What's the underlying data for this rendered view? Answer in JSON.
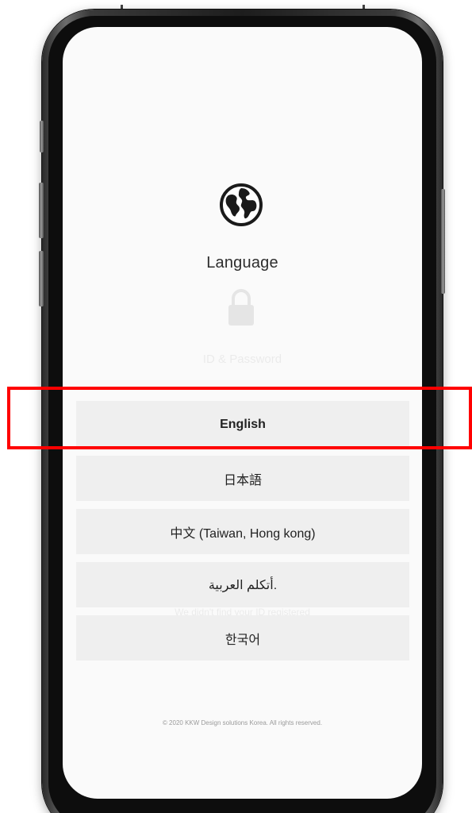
{
  "screen": {
    "title": "Language",
    "icon": "globe-icon",
    "background_hint_1": "ID & Password",
    "background_hint_2": "We didn't find your ID registered"
  },
  "languages": [
    {
      "label": "English",
      "selected": true
    },
    {
      "label": "日本語",
      "selected": false
    },
    {
      "label": "中文 (Taiwan, Hong kong)",
      "selected": false
    },
    {
      "label": "أتكلم العربية.",
      "selected": false
    },
    {
      "label": "한국어",
      "selected": false
    }
  ],
  "footer": {
    "copyright": "© 2020 KKW Design solutions Korea. All rights reserved."
  },
  "colors": {
    "highlight": "#ff0000",
    "item_bg": "#efefef",
    "screen_bg": "#fafafa"
  }
}
